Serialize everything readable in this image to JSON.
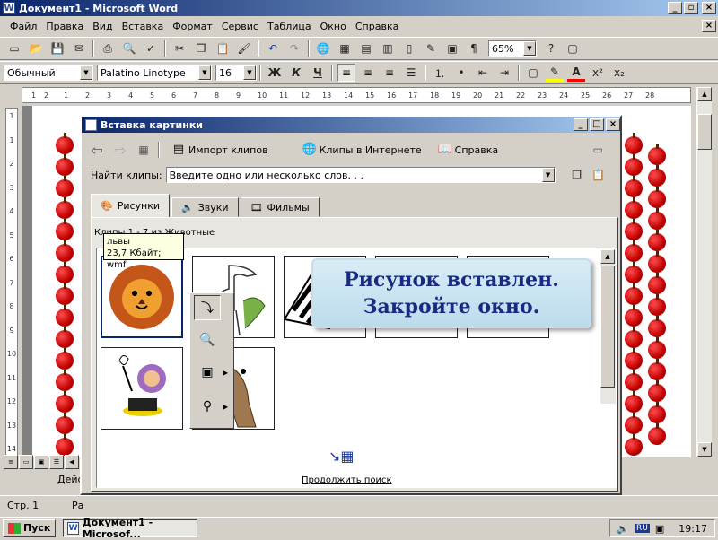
{
  "window": {
    "title": "Документ1 - Microsoft Word",
    "app_icon": "W",
    "controls": [
      "_",
      "▫",
      "×"
    ]
  },
  "menu": [
    "Файл",
    "Правка",
    "Вид",
    "Вставка",
    "Формат",
    "Сервис",
    "Таблица",
    "Окно",
    "Справка"
  ],
  "formatting": {
    "style": "Обычный",
    "font": "Palatino Linotype",
    "size": "16",
    "bold": "Ж",
    "italic": "К",
    "underline": "Ч"
  },
  "standard": {
    "zoom": "65%"
  },
  "ruler": {
    "labels": [
      "1",
      "2",
      "1",
      "2",
      "3",
      "4",
      "5",
      "6",
      "7",
      "8",
      "9",
      "10",
      "11",
      "12",
      "13",
      "14",
      "15",
      "16",
      "17",
      "18",
      "19",
      "20",
      "21",
      "22",
      "23",
      "24",
      "25",
      "26",
      "27",
      "28"
    ]
  },
  "vruler": {
    "labels": [
      "1",
      "1",
      "1",
      "1",
      "2",
      "1",
      "3",
      "1",
      "4",
      "1",
      "5",
      "1",
      "6",
      "1",
      "7",
      "1",
      "8",
      "1",
      "9",
      "1",
      "10",
      "1",
      "11",
      "1",
      "12",
      "1",
      "13",
      "1",
      "14"
    ]
  },
  "dialog": {
    "title": "Вставка картинки",
    "toolbar": {
      "back": "⇦",
      "forward": "⇨",
      "import": "Импорт клипов",
      "online": "Клипы в Интернете",
      "help": "Справка"
    },
    "search_label": "Найти клипы:",
    "search_placeholder": "Введите одно или несколько слов. . .",
    "tabs": [
      "Рисунки",
      "Звуки",
      "Фильмы"
    ],
    "clips_info": "Клипы 1 - 7 из Животные",
    "tooltip": {
      "name": "львы",
      "info": "23,7 Кбайт; wmf"
    },
    "continue_link": "Продолжить поиск"
  },
  "callout": {
    "line1": "Рисунок вставлен.",
    "line2": "Закройте окно."
  },
  "statusbar": {
    "page": "Стр. 1",
    "section": "Ра",
    "action": "Дейс"
  },
  "taskbar": {
    "start": "Пуск",
    "task": "Документ1 - Microsof...",
    "lang": "RU",
    "time": "19:17"
  }
}
